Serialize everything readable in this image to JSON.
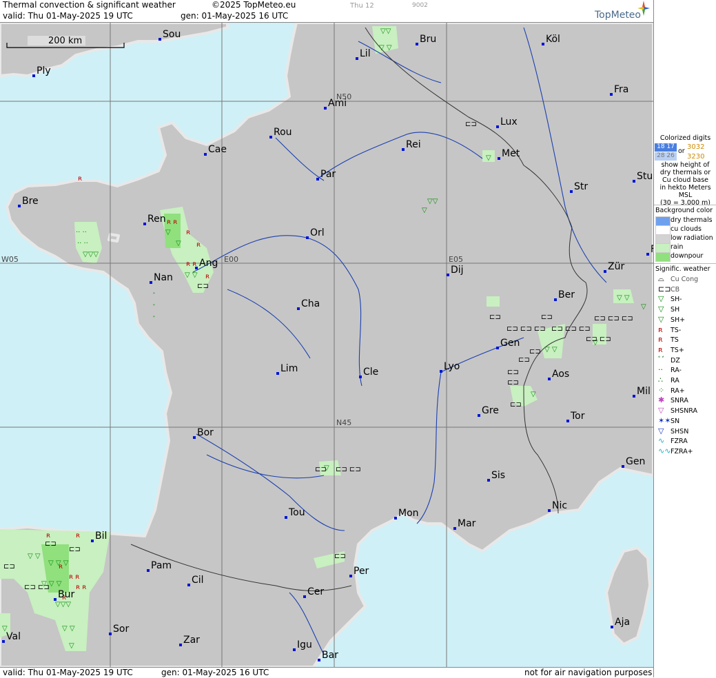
{
  "header": {
    "title": "Thermal convection & significant weather",
    "copyright": "©2025 TopMeteo.eu",
    "valid": "valid:  Thu  01-May-2025  19 UTC",
    "gen": "gen: 01-May-2025 16 UTC",
    "tag1": "Thu 12",
    "tag2": "9002",
    "logo": "TopMeteo"
  },
  "footer": {
    "valid": "valid:  Thu  01-May-2025  19 UTC",
    "gen": "gen: 01-May-2025 16 UTC",
    "disclaimer": "not for air navigation purposes"
  },
  "map": {
    "scale": "200 km",
    "grid_labels": [
      "N50",
      "N45",
      "W05",
      "E00",
      "E05"
    ],
    "cities": [
      "Sou",
      "Ply",
      "Bru",
      "Köl",
      "Lil",
      "Ami",
      "Fra",
      "Lux",
      "Rou",
      "Cae",
      "Rei",
      "Met",
      "Par",
      "Stu",
      "Bre",
      "Str",
      "Ren",
      "Orl",
      "F",
      "W05",
      "Ang",
      "Dij",
      "Zür",
      "Nan",
      "Cha",
      "Ber",
      "Gen",
      "Lim",
      "Cle",
      "Lyo",
      "Aos",
      "Mil",
      "Gre",
      "Tor",
      "Bor",
      "Gen",
      "Sis",
      "Tou",
      "Mon",
      "Mar",
      "Nic",
      "Bil",
      "Pam",
      "Per",
      "Cil",
      "Cer",
      "Bur",
      "Sor",
      "Aja",
      "Val",
      "Zar",
      "Igu",
      "Bar"
    ]
  },
  "legend": {
    "digits_title": [
      "Colorized digits"
    ],
    "digits_a": "18 17",
    "digits_b": "28 26",
    "or": "or",
    "digits_c": "3032",
    "digits_d": "3230",
    "digits_note": [
      "show height of",
      "dry thermals or",
      "Cu cloud base",
      "in hekto Meters",
      "MSL",
      "(30 = 3.000 m)"
    ],
    "bg_title": "Background color",
    "bg_items": [
      {
        "label": "dry thermals",
        "color": "#6fa0ee"
      },
      {
        "label": "cu clouds",
        "color": "#ffffff"
      },
      {
        "label": "low radiation",
        "color": "#d3d3d3"
      },
      {
        "label": "rain",
        "color": "#c8f0c0"
      },
      {
        "label": "downpour",
        "color": "#90e07e"
      }
    ],
    "wx_title": "Signific. weather",
    "wx_items": [
      {
        "label": "Cu Cong",
        "icon": "cucong-icon"
      },
      {
        "label": "CB",
        "icon": "cb-icon"
      },
      {
        "label": "SH-",
        "icon": "shower-light-icon"
      },
      {
        "label": "SH",
        "icon": "shower-icon"
      },
      {
        "label": "SH+",
        "icon": "shower-heavy-icon"
      },
      {
        "label": "TS-",
        "icon": "thunderstorm-light-icon"
      },
      {
        "label": "TS",
        "icon": "thunderstorm-icon"
      },
      {
        "label": "TS+",
        "icon": "thunderstorm-heavy-icon"
      },
      {
        "label": "DZ",
        "icon": "drizzle-icon"
      },
      {
        "label": "RA-",
        "icon": "rain-light-icon"
      },
      {
        "label": "RA",
        "icon": "rain-icon"
      },
      {
        "label": "RA+",
        "icon": "rain-heavy-icon"
      },
      {
        "label": "SNRA",
        "icon": "snow-rain-icon"
      },
      {
        "label": "SHSNRA",
        "icon": "snow-rain-shower-icon"
      },
      {
        "label": "SN",
        "icon": "snow-icon"
      },
      {
        "label": "SHSN",
        "icon": "snow-shower-icon"
      },
      {
        "label": "FZRA",
        "icon": "freezing-rain-icon"
      },
      {
        "label": "FZRA+",
        "icon": "freezing-rain-heavy-icon"
      }
    ]
  }
}
